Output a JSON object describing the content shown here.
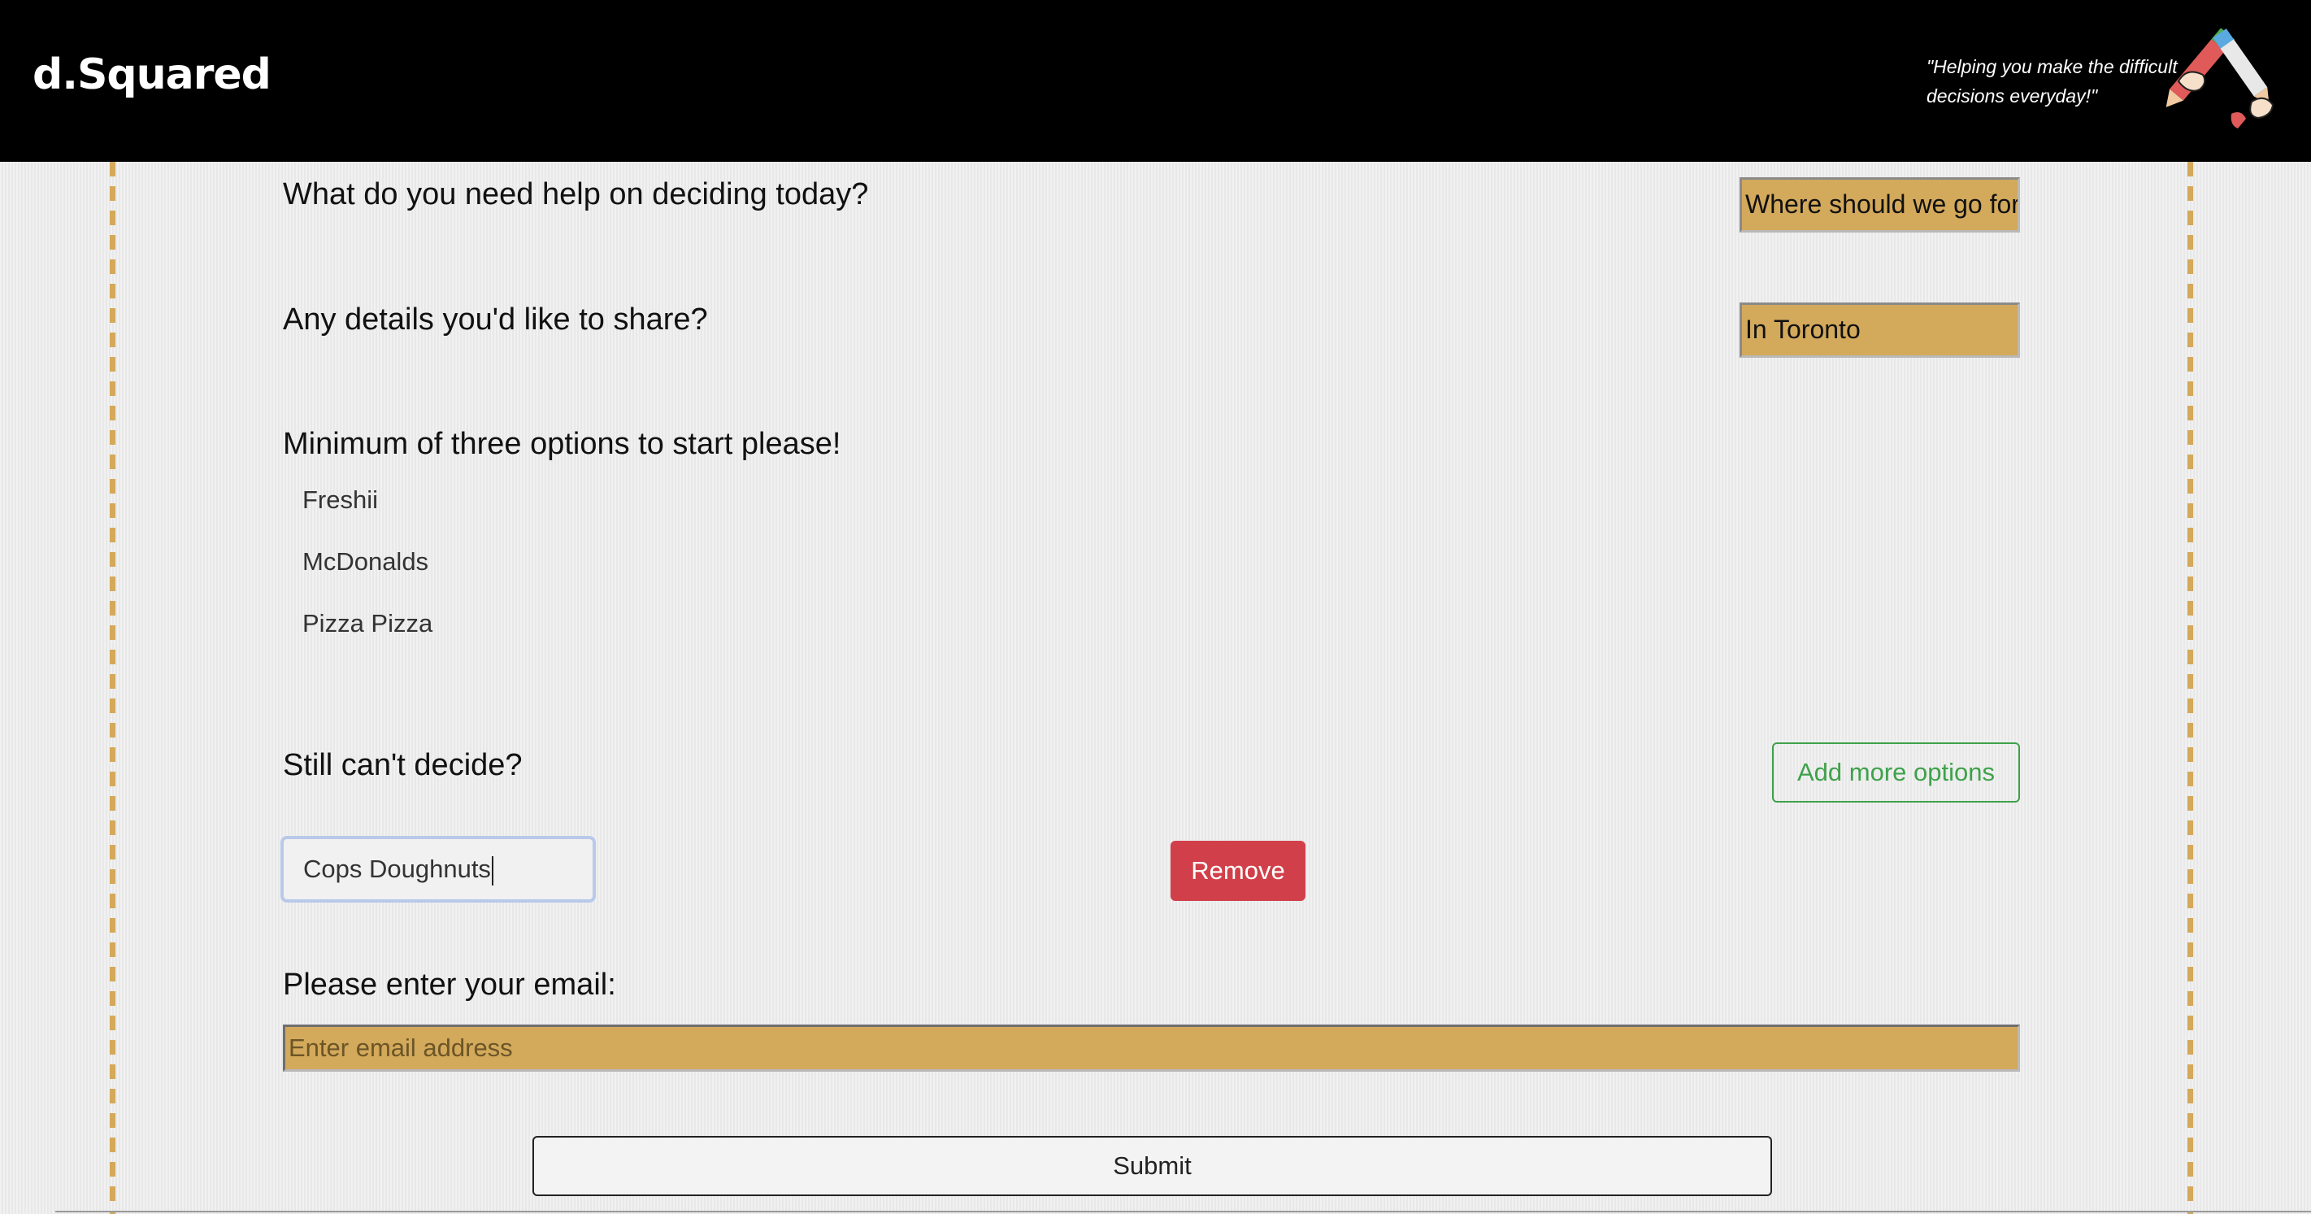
{
  "header": {
    "logo": "d.Squared",
    "tagline": "\"Helping you make the difficult decisions everyday!\"",
    "logo_art_icon": "crossed-hands-pens-icon"
  },
  "form": {
    "question_label": "What do you need help on deciding today?",
    "question_value": "Where should we go for",
    "details_label": "Any details you'd like to share?",
    "details_value": "In Toronto",
    "options_label": "Minimum of three options to start please!",
    "options": [
      "Freshii",
      "McDonalds",
      "Pizza Pizza"
    ],
    "still_label": "Still can't decide?",
    "add_more_label": "Add more options",
    "new_option_value": "Cops Doughnuts",
    "remove_label": "Remove",
    "email_label": "Please enter your email:",
    "email_placeholder": "Enter email address",
    "submit_label": "Submit"
  },
  "colors": {
    "header_bg": "#000000",
    "field_gold": "#d3a95b",
    "remove_red": "#d1404a",
    "add_green": "#3fa14b",
    "dash_gold": "#d4a95a"
  }
}
